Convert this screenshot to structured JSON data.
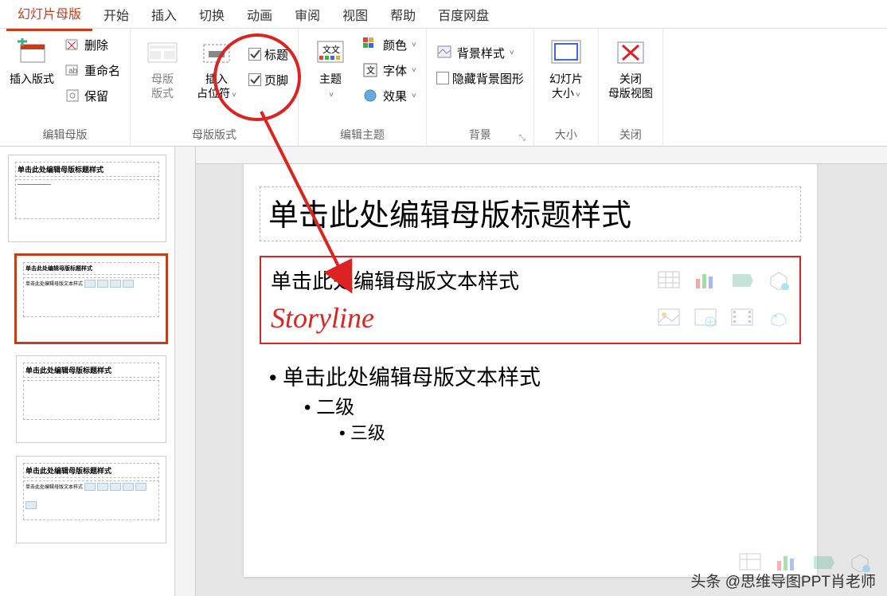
{
  "tabs": {
    "active": "幻灯片母版",
    "items": [
      "幻灯片母版",
      "开始",
      "插入",
      "切换",
      "动画",
      "审阅",
      "视图",
      "帮助",
      "百度网盘"
    ]
  },
  "ribbon": {
    "editMaster": {
      "label": "编辑母版",
      "insertLayout": "插入版式",
      "delete": "删除",
      "rename": "重命名",
      "preserve": "保留"
    },
    "masterLayout": {
      "label": "母版版式",
      "masterLayoutBtn": "母版\n版式",
      "insertPlaceholder": "插入\n占位符",
      "titleChk": "标题",
      "footerChk": "页脚"
    },
    "editTheme": {
      "label": "编辑主题",
      "themes": "主题",
      "colors": "颜色",
      "fonts": "字体",
      "effects": "效果"
    },
    "background": {
      "label": "背景",
      "bgStyles": "背景样式",
      "hideBg": "隐藏背景图形"
    },
    "size": {
      "label": "大小",
      "slideSize": "幻灯片\n大小"
    },
    "close": {
      "label": "关闭",
      "closeMaster": "关闭\n母版视图"
    }
  },
  "slide": {
    "title": "单击此处编辑母版标题样式",
    "contentText": "单击此处编辑母版文本样式",
    "storyline": "Storyline",
    "bulletL1": "单击此处编辑母版文本样式",
    "bulletL2": "二级",
    "bulletL3": "三级"
  },
  "thumbs": {
    "t1": "单击此处编辑母版标题样式",
    "t3": "单击此处编辑母版标题样式",
    "t4": "单击此处编辑母版标题样式"
  },
  "watermark": "头条 @思维导图PPT肖老师"
}
